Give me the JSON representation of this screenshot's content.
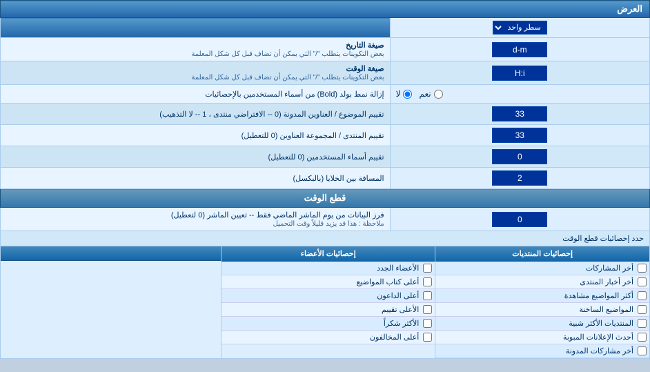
{
  "page": {
    "title": "العرض",
    "sections": {
      "display": {
        "label": "العرض",
        "rows": [
          {
            "id": "row-per-page",
            "label": "سطر واحد",
            "is_dropdown": true,
            "value": "سطر واحد"
          },
          {
            "id": "date-format",
            "label": "صيغة التاريخ",
            "sublabel": "بعض التكوينات يتطلب \"/\" التي يمكن أن تضاف قبل كل شكل المعلمة",
            "value": "d-m"
          },
          {
            "id": "time-format",
            "label": "صيغة الوقت",
            "sublabel": "بعض التكوينات يتطلب \"/\" التي يمكن أن تضاف قبل كل شكل المعلمة",
            "value": "H:i"
          },
          {
            "id": "remove-bold",
            "label": "إزالة نمط بولد (Bold) من أسماء المستخدمين بالإحصائيات",
            "is_radio": true,
            "radio_yes": "نعم",
            "radio_no": "لا",
            "selected": "no"
          },
          {
            "id": "topic-order",
            "label": "تقييم الموضوع / العناوين المدونة (0 -- الافتراضي منتدى ، 1 -- لا التذهيب)",
            "value": "33"
          },
          {
            "id": "forum-order",
            "label": "تقييم المنتدى / المجموعة العناوين (0 للتعطيل)",
            "value": "33"
          },
          {
            "id": "user-names",
            "label": "تقييم أسماء المستخدمين (0 للتعطيل)",
            "value": "0"
          },
          {
            "id": "cell-spacing",
            "label": "المسافة بين الخلايا (بالبكسل)",
            "value": "2"
          }
        ]
      },
      "time_cut": {
        "label": "قطع الوقت",
        "rows": [
          {
            "id": "fetch-days",
            "label": "فرز البيانات من يوم الماشر الماضي فقط -- تعيين الماشر (0 لتعطيل)",
            "sublabel": "ملاحظة : هذا قد يزيد قليلاً وقت التحميل",
            "value": "0"
          }
        ]
      },
      "stats_limit": {
        "label": "حدد إحصائيات قطع الوقت"
      }
    },
    "stats_columns": [
      {
        "id": "col-posts",
        "header": "إحصائيات المنتديات",
        "items": [
          {
            "id": "item-last-posts",
            "label": "أخر المشاركات",
            "checked": false
          },
          {
            "id": "item-forum-news",
            "label": "أخر أخبار المنتدى",
            "checked": false
          },
          {
            "id": "item-most-views",
            "label": "أكثر المواضيع مشاهدة",
            "checked": false
          },
          {
            "id": "item-hot-topics",
            "label": "المواضيع الساخنة",
            "checked": false
          },
          {
            "id": "item-similar-forums",
            "label": "المنتديات الأكثر شبية",
            "checked": false
          },
          {
            "id": "item-last-ads",
            "label": "أحدث الإعلانات المبوبة",
            "checked": false
          },
          {
            "id": "item-last-blog",
            "label": "أخر مشاركات المدونة",
            "checked": false
          }
        ]
      },
      {
        "id": "col-members",
        "header": "إحصائيات الأعضاء",
        "items": [
          {
            "id": "item-new-members",
            "label": "الأعضاء الجدد",
            "checked": false
          },
          {
            "id": "item-top-posters",
            "label": "أعلى كتاب المواضيع",
            "checked": false
          },
          {
            "id": "item-top-online",
            "label": "أعلى الداعون",
            "checked": false
          },
          {
            "id": "item-top-rate",
            "label": "الأعلى تقييم",
            "checked": false
          },
          {
            "id": "item-most-thanks",
            "label": "الأكثر شكراً",
            "checked": false
          },
          {
            "id": "item-top-ignore",
            "label": "أعلى المخالفون",
            "checked": false
          }
        ]
      }
    ]
  }
}
